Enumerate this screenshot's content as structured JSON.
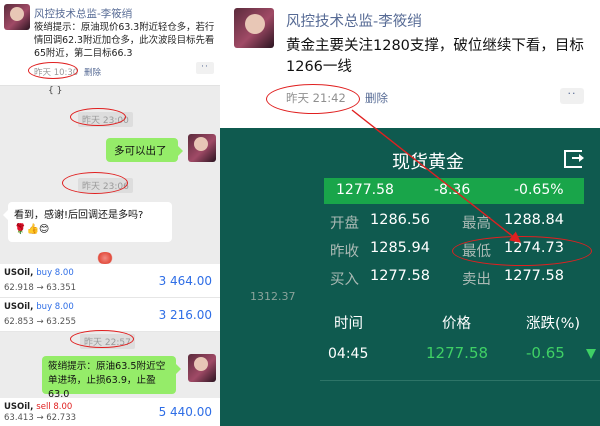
{
  "left_feed": {
    "top_post": {
      "author": "风控技术总监-李筱绡",
      "text": "筱绡提示：原油现价63.3附近轻仓多，若行情回调62.3附近加仓多，此次波段目标先看65附近，第二目标66.3",
      "time": "昨天 10:30",
      "delete_label": "删除",
      "more_label": "··"
    },
    "bracket": "{ }",
    "timestamps": [
      "昨天 23:00",
      "昨天 23:06",
      "昨天 22:57"
    ],
    "chat": {
      "msg_sent": "多可以出了",
      "msg_received": "看到，感谢!后回调还是多吗?",
      "emoji": "🌹👍😊",
      "msg_signal": "筱绡提示：原油63.5附近空单进场，止损63.9，止盈63.0"
    },
    "trades": [
      {
        "symbol": "USOil,",
        "side": "buy 8.00",
        "side_color": "#2f6ee6",
        "prices": "62.918 → 63.351",
        "profit": "3 464.00"
      },
      {
        "symbol": "USOil,",
        "side": "buy 8.00",
        "side_color": "#2f6ee6",
        "prices": "62.853 → 63.255",
        "profit": "3 216.00"
      },
      {
        "symbol": "USOil,",
        "side": "sell 8.00",
        "side_color": "#e02020",
        "prices": "63.413 → 62.733",
        "profit": "5 440.00"
      }
    ]
  },
  "right_post": {
    "author": "风控技术总监-李筱绡",
    "text": "黄金主要关注1280支撑，破位继续下看，目标1266一线",
    "time": "昨天 21:42",
    "delete_label": "删除",
    "more_label": "··"
  },
  "quote": {
    "title": "现货黄金",
    "price": "1277.58",
    "change": "-8.36",
    "change_pct": "-0.65%",
    "open_label": "开盘",
    "open": "1286.56",
    "high_label": "最高",
    "high": "1288.84",
    "prev_label": "昨收",
    "prev": "1285.94",
    "low_label": "最低",
    "low": "1274.73",
    "bid_label": "买入",
    "bid": "1277.58",
    "ask_label": "卖出",
    "ask": "1277.58",
    "side_number": "1312.37",
    "col_time": "时间",
    "col_price": "价格",
    "col_change": "涨跌(%)",
    "row_time": "04:45",
    "row_price": "1277.58",
    "row_change": "-0.65"
  },
  "colors": {
    "up_green": "#19a54a",
    "panel": "#0f5a4f",
    "annotation_red": "#e02020",
    "wechat_link": "#576b95"
  }
}
